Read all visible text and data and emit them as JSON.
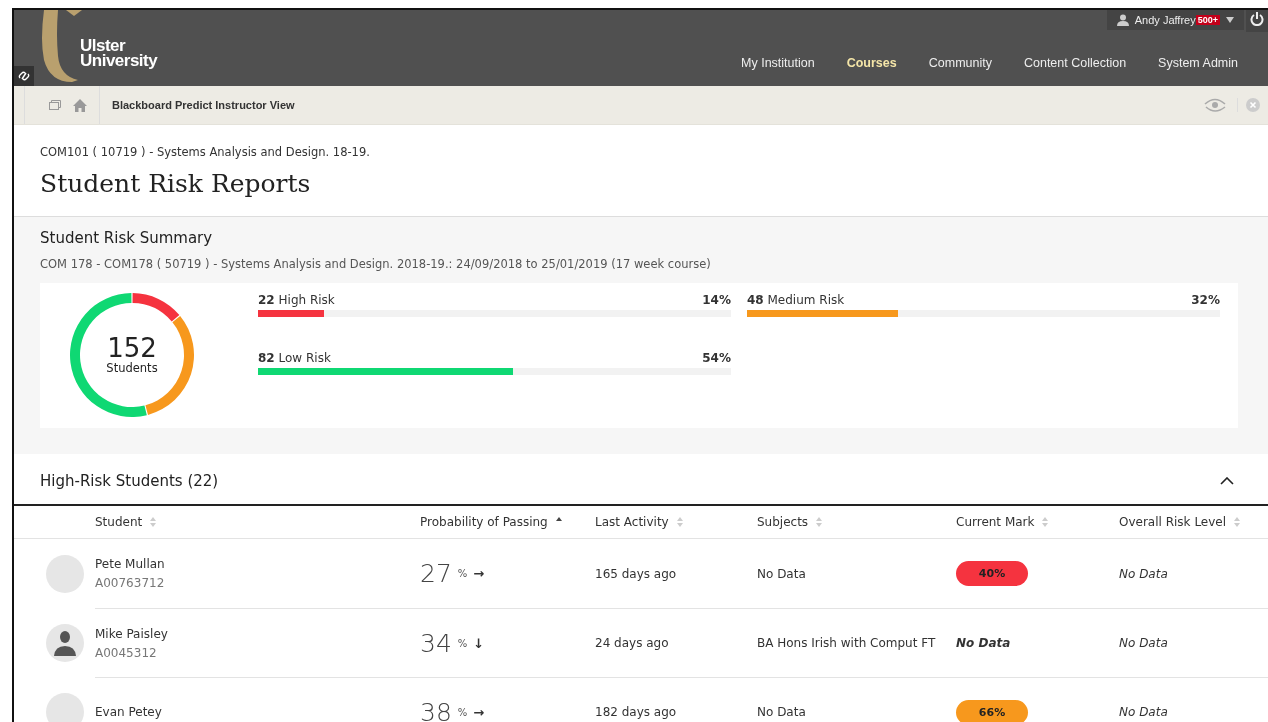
{
  "header": {
    "logo": {
      "line1": "Ulster",
      "line2": "University"
    },
    "nav": [
      {
        "label": "My Institution",
        "selected": false
      },
      {
        "label": "Courses",
        "selected": true
      },
      {
        "label": "Community",
        "selected": false
      },
      {
        "label": "Content Collection",
        "selected": false
      },
      {
        "label": "System Admin",
        "selected": false
      }
    ],
    "user": {
      "name": "Andy Jaffrey",
      "badge": "500+"
    }
  },
  "breadcrumb": {
    "title": "Blackboard Predict Instructor View"
  },
  "course_label": "COM101 ( 10719 ) - Systems Analysis and Design. 18-19.",
  "page_title": "Student Risk Reports",
  "summary": {
    "title": "Student Risk Summary",
    "subtitle": "COM 178 - COM178 ( 50719 ) - Systems Analysis and Design. 2018-19.: 24/09/2018 to 25/01/2019 (17 week course)",
    "total": "152",
    "total_label": "Students",
    "chart_data": {
      "type": "donut",
      "categories": [
        "High Risk",
        "Medium Risk",
        "Low Risk"
      ],
      "values": [
        14,
        32,
        54
      ]
    },
    "risk_groups": [
      {
        "count": "22",
        "percent": "14%",
        "level": 0.14,
        "color": "#f5333f"
      },
      {
        "count": "48",
        "percent": "32%",
        "level": 0.32,
        "color": "#f7981d"
      },
      {
        "count": "82",
        "percent": "54%",
        "level": 0.54,
        "color": "#0fd873"
      }
    ]
  },
  "high_risk": {
    "title": "High-Risk Students (22)",
    "expanded": true,
    "columns": [
      {
        "label": "Student",
        "sorted": false
      },
      {
        "label": "Probability of Passing",
        "sorted": true
      },
      {
        "label": "Last Activity",
        "sorted": false
      },
      {
        "label": "Subjects",
        "sorted": false
      },
      {
        "label": "Current Mark",
        "sorted": false
      },
      {
        "label": "Overall Risk Level",
        "sorted": false
      }
    ],
    "rows": [
      {
        "avatar": {
          "kind": "blank"
        },
        "name": "Pete Mullan",
        "id": "A00763712",
        "probability": "27",
        "percent_sign": "%",
        "trend": "→",
        "last_activity": "165 days ago",
        "subjects": "No Data",
        "mark": {
          "kind": "pill",
          "text": "40%",
          "color": "#f5333f"
        },
        "risk": "No Data"
      },
      {
        "avatar": {
          "kind": "silhouette"
        },
        "name": "Mike Paisley",
        "id": "A0045312",
        "probability": "34",
        "percent_sign": "%",
        "trend": "↓",
        "last_activity": "24 days ago",
        "subjects": "BA Hons Irish with Comput FT",
        "mark": {
          "kind": "plain",
          "text": "No Data"
        },
        "risk": "No Data"
      },
      {
        "avatar": {
          "kind": "blank"
        },
        "name": "Evan Petey",
        "probability": "38",
        "percent_sign": "%",
        "trend": "→",
        "last_activity": "182 days ago",
        "subjects": "No Data",
        "mark": {
          "kind": "pill",
          "text": "66%",
          "color": "#f7981d"
        },
        "risk": "No Data"
      }
    ]
  }
}
